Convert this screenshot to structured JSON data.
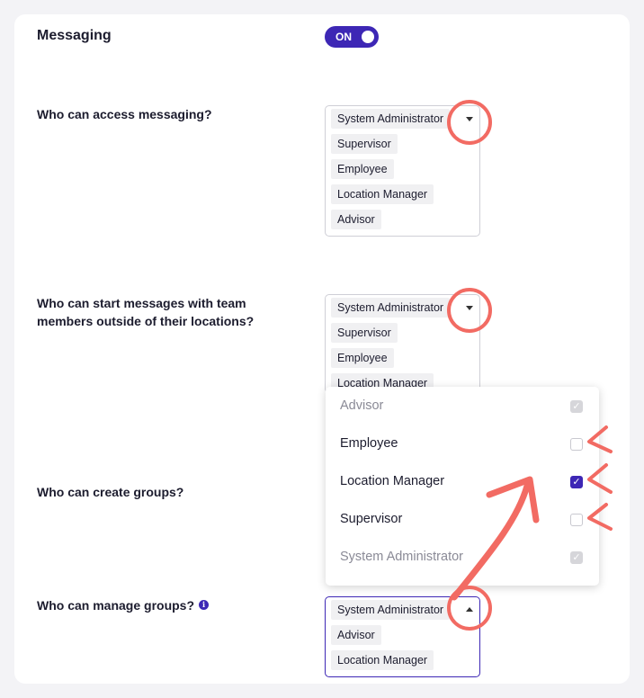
{
  "section": {
    "title": "Messaging",
    "toggle_label": "ON"
  },
  "questions": [
    {
      "label": "Who can access messaging?",
      "chips": [
        "System Administrator",
        "Supervisor",
        "Employee",
        "Location Manager",
        "Advisor"
      ]
    },
    {
      "label_line1": "Who can start messages with team",
      "label_line2": "members outside of their locations?",
      "chips": [
        "System Administrator",
        "Supervisor",
        "Employee",
        "Location Manager"
      ]
    },
    {
      "label": "Who can create groups?"
    },
    {
      "label": "Who can manage groups?",
      "chips": [
        "System Administrator",
        "Advisor",
        "Location Manager"
      ]
    }
  ],
  "dropdown": {
    "options": [
      {
        "label": "Advisor",
        "state": "checked-disabled"
      },
      {
        "label": "Employee",
        "state": "unchecked"
      },
      {
        "label": "Location Manager",
        "state": "checked"
      },
      {
        "label": "Supervisor",
        "state": "unchecked"
      },
      {
        "label": "System Administrator",
        "state": "checked-disabled"
      }
    ]
  },
  "icons": {
    "info": "info-icon",
    "caret_down": "chevron-down-icon",
    "caret_up": "chevron-up-icon",
    "checkmark": "✓"
  },
  "colors": {
    "accent": "#3d27b5",
    "annotation": "#f26b63"
  }
}
